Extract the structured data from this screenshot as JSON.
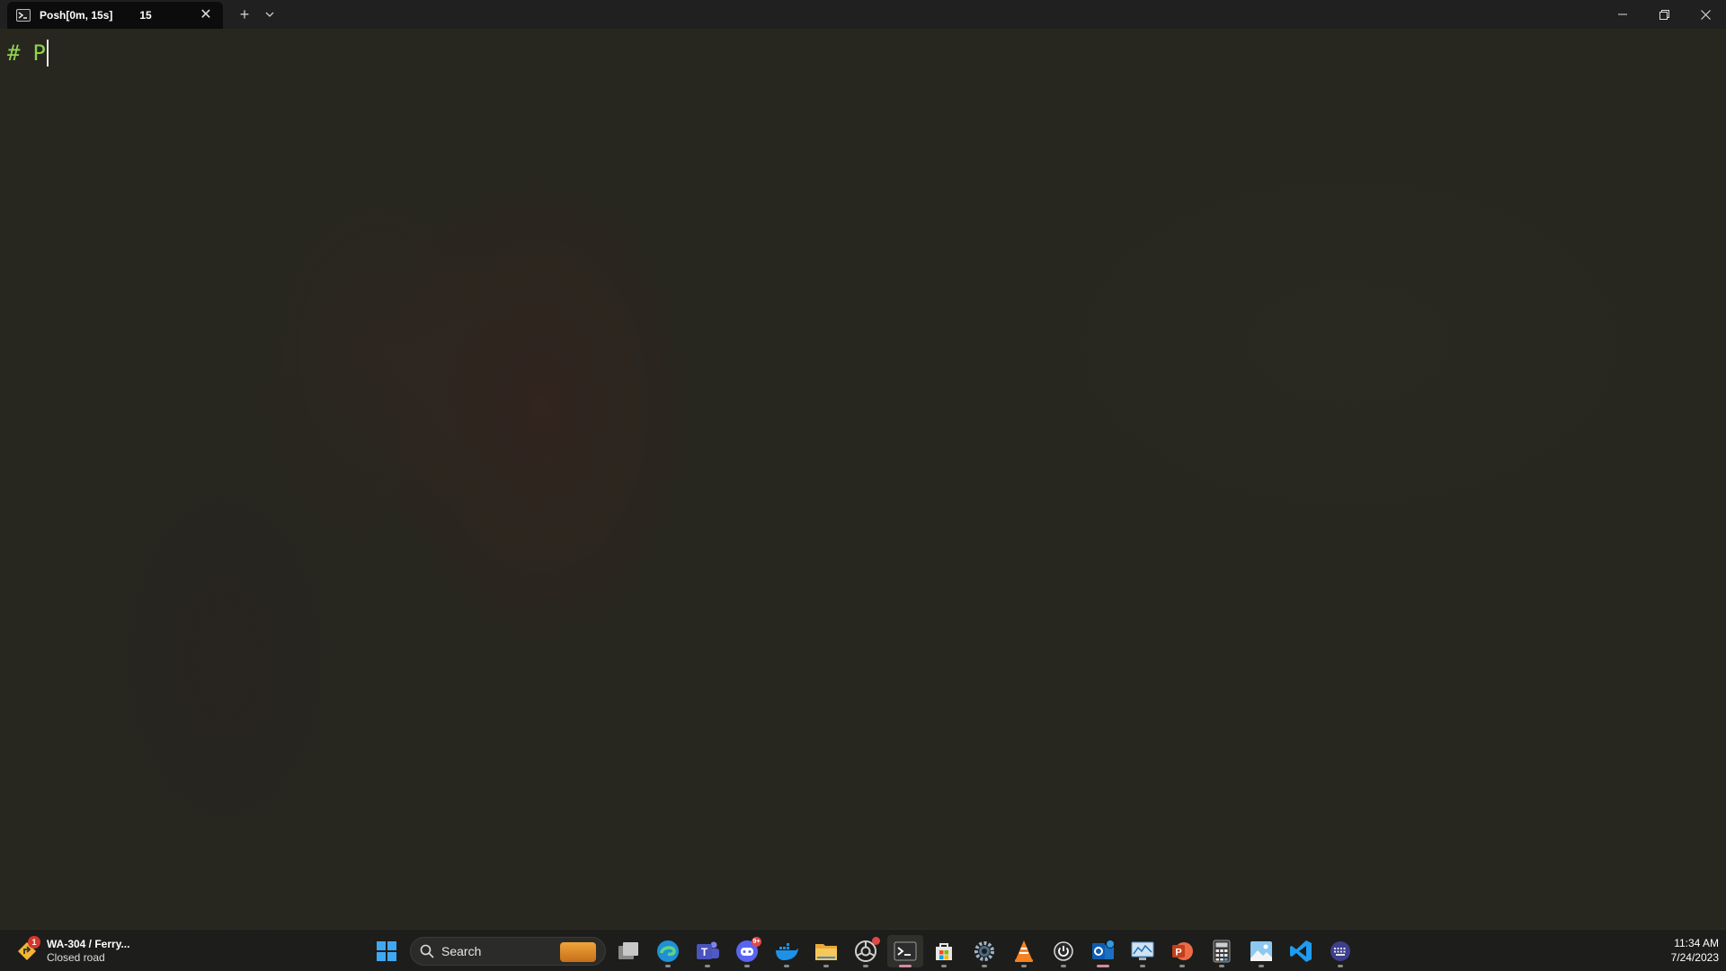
{
  "window": {
    "tab_title": "Posh[0m, 15s]",
    "tab_count": "15",
    "new_tab_glyph": "+",
    "close_glyph": "✕"
  },
  "terminal": {
    "prompt_symbol": "#",
    "input_text": "P",
    "prompt_color": "#8fd34e"
  },
  "taskbar": {
    "widget": {
      "badge": "1",
      "title": "WA-304 / Ferry...",
      "subtitle": "Closed road"
    },
    "search": {
      "label": "Search"
    },
    "apps": [
      "windows-start-icon",
      "task-view-icon",
      "edge-icon",
      "teams-icon",
      "discord-icon",
      "docker-icon",
      "file-explorer-icon",
      "chromium-icon",
      "terminal-icon",
      "store-icon",
      "settings-icon",
      "vlc-icon",
      "power-icon",
      "outlook-icon",
      "monitor-icon",
      "powerpoint-icon",
      "calculator-icon",
      "photos-icon",
      "vscode-icon",
      "keyboard-icon"
    ],
    "discord_badge": "9+",
    "clock": {
      "time": "11:34 AM",
      "date": "7/24/2023"
    }
  }
}
